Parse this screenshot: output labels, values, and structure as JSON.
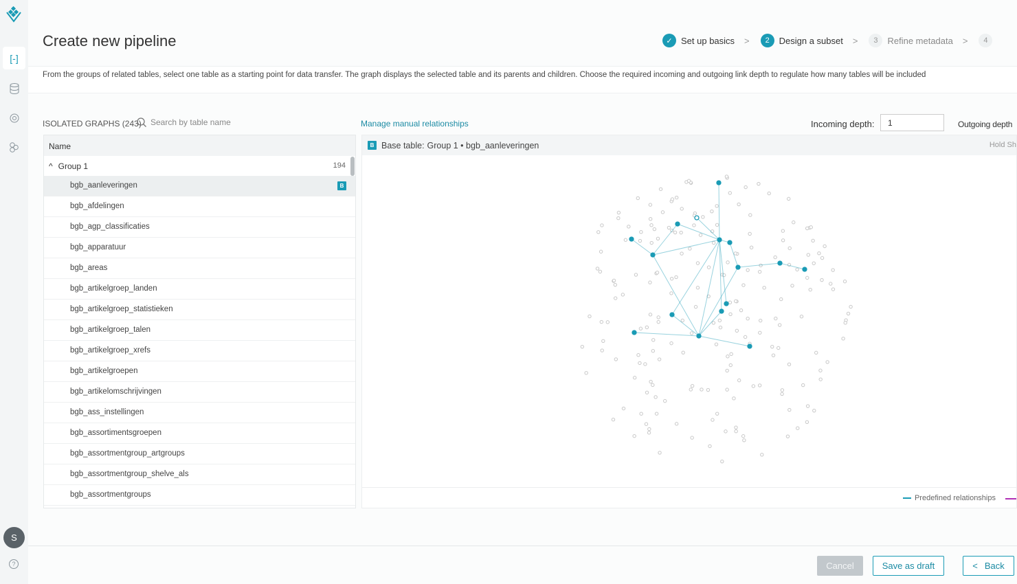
{
  "sidebar": {
    "items": [
      "pipelines-icon",
      "database-icon",
      "target-icon",
      "entities-icon"
    ],
    "avatar": "S",
    "help": "?"
  },
  "header": {
    "title": "Create new pipeline"
  },
  "steps": [
    {
      "num": "✓",
      "label": "Set up basics",
      "state": "done"
    },
    {
      "num": "2",
      "label": "Design a subset",
      "state": "current"
    },
    {
      "num": "3",
      "label": "Refine metadata",
      "state": "todo"
    },
    {
      "num": "4",
      "label": "",
      "state": "todo"
    }
  ],
  "description": "From the groups of related tables, select one table as a starting point for data transfer. The graph displays the selected table and its parents and children. Choose the required incoming and outgoing link depth to regulate how many tables will be included",
  "list": {
    "title": "ISOLATED GRAPHS (243)",
    "search_placeholder": "Search by table name",
    "column": "Name",
    "group": {
      "label": "Group 1",
      "count": "194"
    },
    "base_badge": "B",
    "rows": [
      "bgb_aanleveringen",
      "bgb_afdelingen",
      "bgb_agp_classificaties",
      "bgb_apparatuur",
      "bgb_areas",
      "bgb_artikelgroep_landen",
      "bgb_artikelgroep_statistieken",
      "bgb_artikelgroep_talen",
      "bgb_artikelgroep_xrefs",
      "bgb_artikelgroepen",
      "bgb_artikelomschrijvingen",
      "bgb_ass_instellingen",
      "bgb_assortimentsgroepen",
      "bgb_assortmentgroup_artgroups",
      "bgb_assortmentgroup_shelve_als",
      "bgb_assortmentgroups"
    ]
  },
  "graph": {
    "manage_link": "Manage manual relationships",
    "incoming_label": "Incoming depth:",
    "incoming_value": "1",
    "outgoing_label": "Outgoing depth",
    "base_badge": "B",
    "base_label": "Base table:",
    "base_value": "Group 1 • bgb_aanleveringen",
    "hint": "Hold Sh",
    "legend_predefined": "Predefined relationships",
    "colors": {
      "accent": "#1a9bb5",
      "manual": "#b02fb5",
      "inactive": "#c8c8c8"
    }
  },
  "footer": {
    "cancel": "Cancel",
    "save_draft": "Save as draft",
    "back": "Back"
  }
}
